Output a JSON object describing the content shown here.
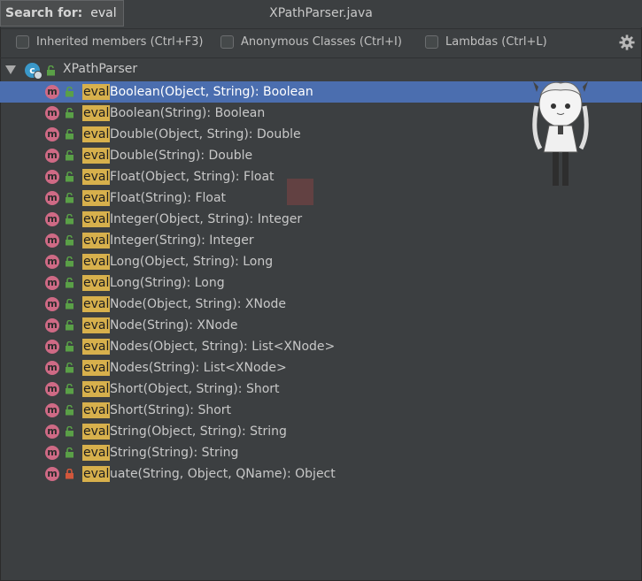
{
  "search": {
    "label": "Search for:",
    "value": "eval"
  },
  "window": {
    "title": "XPathParser.java"
  },
  "options": [
    {
      "label": "Inherited members (Ctrl+F3)"
    },
    {
      "label": "Anonymous Classes (Ctrl+I)"
    },
    {
      "label": "Lambdas (Ctrl+L)"
    }
  ],
  "tree": {
    "root": {
      "label": "XPathParser",
      "icon": "class-icon",
      "icon_letter": "c"
    },
    "method_icon_letter": "m",
    "highlight": "eval",
    "items": [
      {
        "match": "eval",
        "rest": "Boolean(Object, String): Boolean",
        "visibility": "public",
        "selected": true
      },
      {
        "match": "eval",
        "rest": "Boolean(String): Boolean",
        "visibility": "public"
      },
      {
        "match": "eval",
        "rest": "Double(Object, String): Double",
        "visibility": "public"
      },
      {
        "match": "eval",
        "rest": "Double(String): Double",
        "visibility": "public"
      },
      {
        "match": "eval",
        "rest": "Float(Object, String): Float",
        "visibility": "public"
      },
      {
        "match": "eval",
        "rest": "Float(String): Float",
        "visibility": "public"
      },
      {
        "match": "eval",
        "rest": "Integer(Object, String): Integer",
        "visibility": "public"
      },
      {
        "match": "eval",
        "rest": "Integer(String): Integer",
        "visibility": "public"
      },
      {
        "match": "eval",
        "rest": "Long(Object, String): Long",
        "visibility": "public"
      },
      {
        "match": "eval",
        "rest": "Long(String): Long",
        "visibility": "public"
      },
      {
        "match": "eval",
        "rest": "Node(Object, String): XNode",
        "visibility": "public"
      },
      {
        "match": "eval",
        "rest": "Node(String): XNode",
        "visibility": "public"
      },
      {
        "match": "eval",
        "rest": "Nodes(Object, String): List<XNode>",
        "visibility": "public"
      },
      {
        "match": "eval",
        "rest": "Nodes(String): List<XNode>",
        "visibility": "public"
      },
      {
        "match": "eval",
        "rest": "Short(Object, String): Short",
        "visibility": "public"
      },
      {
        "match": "eval",
        "rest": "Short(String): Short",
        "visibility": "public"
      },
      {
        "match": "eval",
        "rest": "String(Object, String): String",
        "visibility": "public"
      },
      {
        "match": "eval",
        "rest": "String(String): String",
        "visibility": "public"
      },
      {
        "match": "eval",
        "rest": "uate(String, Object, QName): Object",
        "visibility": "private"
      }
    ]
  },
  "colors": {
    "background": "#3c3f41",
    "selection": "#4b6eaf",
    "match_highlight": "#d7b04c",
    "method_icon": "#cf6a85",
    "class_icon": "#3a98c9",
    "public_lock": "#5aa047",
    "private_lock": "#d2573b"
  },
  "icons": {
    "gear": "gear-icon",
    "expand": "triangle-down-icon",
    "public": "unlocked-icon",
    "private": "locked-icon"
  }
}
